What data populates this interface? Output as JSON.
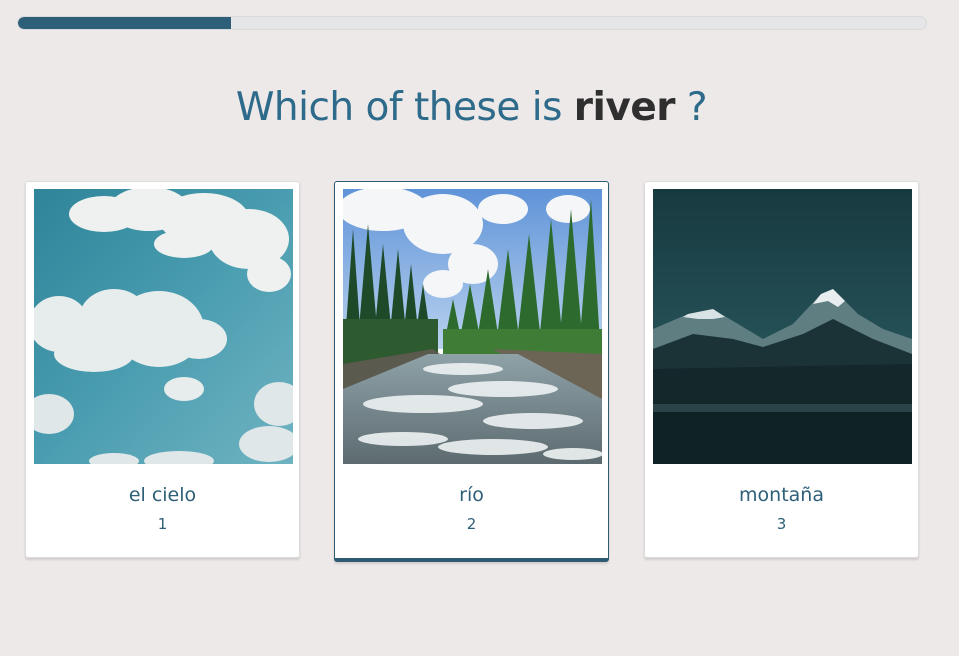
{
  "progress": {
    "fraction": 0.235
  },
  "question": {
    "prefix": "Which of these is",
    "keyword": "river",
    "suffix": "?"
  },
  "options": [
    {
      "label": "el cielo",
      "number": "1",
      "image": "sky-with-clouds",
      "selected": false
    },
    {
      "label": "río",
      "number": "2",
      "image": "river-in-forest",
      "selected": true
    },
    {
      "label": "montaña",
      "number": "3",
      "image": "snowy-mountains",
      "selected": false
    }
  ],
  "colors": {
    "accent": "#2e5f78",
    "background": "#ede9e8",
    "keyword": "#2f2f2f"
  }
}
